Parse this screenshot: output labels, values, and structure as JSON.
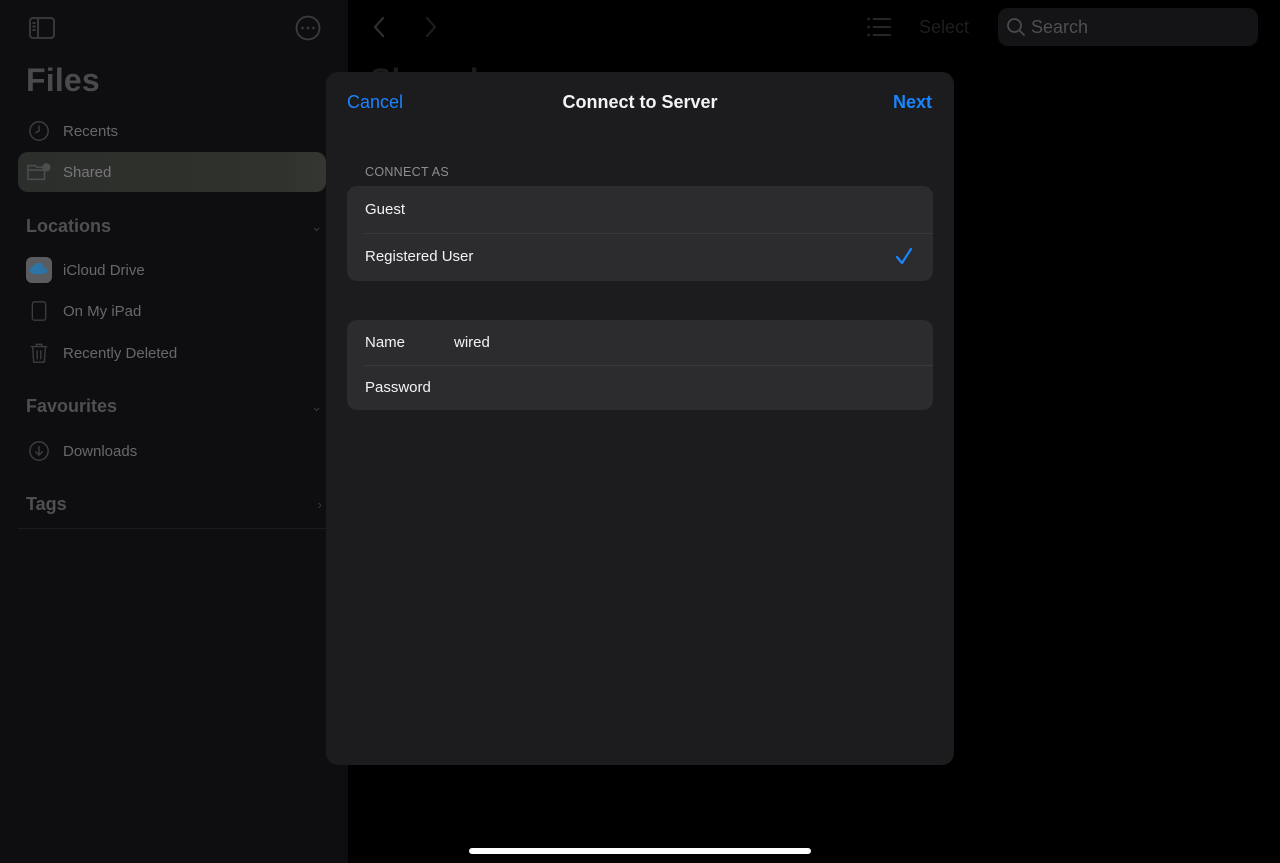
{
  "sidebar": {
    "title": "Files",
    "items_top": [
      {
        "label": "Recents",
        "icon": "clock-icon"
      },
      {
        "label": "Shared",
        "icon": "shared-folder-icon",
        "selected": true
      }
    ],
    "sections": [
      {
        "title": "Locations",
        "state": "expanded",
        "items": [
          {
            "label": "iCloud Drive",
            "icon": "icloud-icon"
          },
          {
            "label": "On My iPad",
            "icon": "ipad-icon"
          },
          {
            "label": "Recently Deleted",
            "icon": "trash-icon"
          }
        ]
      },
      {
        "title": "Favourites",
        "state": "expanded",
        "items": [
          {
            "label": "Downloads",
            "icon": "download-icon"
          }
        ]
      },
      {
        "title": "Tags",
        "state": "collapsed",
        "items": []
      }
    ]
  },
  "toolbar": {
    "select_label": "Select",
    "search_placeholder": "Search"
  },
  "background": {
    "title": "Shared"
  },
  "modal": {
    "title": "Connect to Server",
    "cancel_label": "Cancel",
    "next_label": "Next",
    "connect_as_label": "CONNECT AS",
    "connect_options": [
      {
        "label": "Guest",
        "selected": false
      },
      {
        "label": "Registered User",
        "selected": true
      }
    ],
    "fields": {
      "name_label": "Name",
      "name_value": "wired",
      "password_label": "Password",
      "password_value": ""
    }
  },
  "colors": {
    "accent": "#1a84ff",
    "modal_bg": "#1c1c1e",
    "group_bg": "#2c2c2e"
  }
}
